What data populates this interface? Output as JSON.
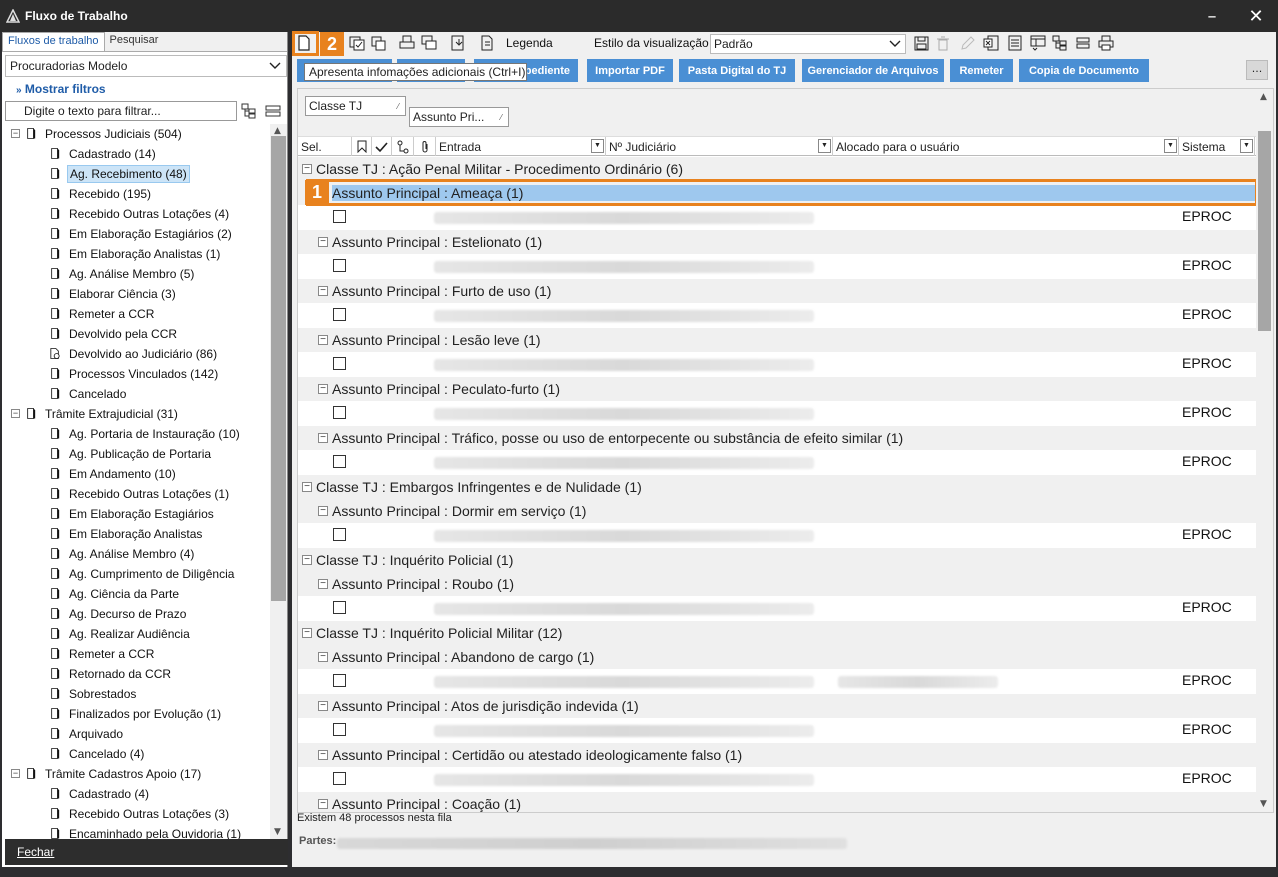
{
  "window": {
    "title": "Fluxo de Trabalho",
    "minimize_glyph": "–",
    "close_glyph": "✕"
  },
  "left": {
    "tabs": [
      "Fluxos de trabalho",
      "Pesquisar"
    ],
    "model_select": "Procuradorias Modelo",
    "show_filters": "Mostrar filtros",
    "filter_placeholder": "Digite o texto para filtrar...",
    "tree": [
      {
        "label": "Processos Judiciais (504)",
        "level": 0,
        "expander": "−"
      },
      {
        "label": "Cadastrado (14)",
        "level": 1
      },
      {
        "label": "Ag. Recebimento (48)",
        "level": 1,
        "selected": true
      },
      {
        "label": "Recebido (195)",
        "level": 1
      },
      {
        "label": "Recebido Outras Lotações (4)",
        "level": 1
      },
      {
        "label": "Em Elaboração Estagiários (2)",
        "level": 1
      },
      {
        "label": "Em Elaboração Analistas (1)",
        "level": 1
      },
      {
        "label": "Ag. Análise Membro (5)",
        "level": 1
      },
      {
        "label": "Elaborar Ciência (3)",
        "level": 1
      },
      {
        "label": "Remeter a CCR",
        "level": 1
      },
      {
        "label": "Devolvido pela CCR",
        "level": 1
      },
      {
        "label": "Devolvido ao Judiciário (86)",
        "level": 1,
        "icon": "gear-doc"
      },
      {
        "label": "Processos Vinculados (142)",
        "level": 1
      },
      {
        "label": "Cancelado",
        "level": 1
      },
      {
        "label": "Trâmite Extrajudicial (31)",
        "level": 0,
        "expander": "−"
      },
      {
        "label": "Ag. Portaria de Instauração (10)",
        "level": 1
      },
      {
        "label": "Ag. Publicação de Portaria",
        "level": 1
      },
      {
        "label": "Em Andamento (10)",
        "level": 1
      },
      {
        "label": "Recebido Outras Lotações (1)",
        "level": 1
      },
      {
        "label": "Em Elaboração Estagiários",
        "level": 1
      },
      {
        "label": "Em Elaboração Analistas",
        "level": 1
      },
      {
        "label": "Ag. Análise Membro (4)",
        "level": 1
      },
      {
        "label": "Ag. Cumprimento de Diligência",
        "level": 1
      },
      {
        "label": "Ag. Ciência da Parte",
        "level": 1
      },
      {
        "label": "Ag. Decurso de Prazo",
        "level": 1
      },
      {
        "label": "Ag. Realizar Audiência",
        "level": 1
      },
      {
        "label": "Remeter a CCR",
        "level": 1
      },
      {
        "label": "Retornado da CCR",
        "level": 1
      },
      {
        "label": "Sobrestados",
        "level": 1
      },
      {
        "label": "Finalizados por Evolução (1)",
        "level": 1
      },
      {
        "label": "Arquivado",
        "level": 1
      },
      {
        "label": "Cancelado (4)",
        "level": 1
      },
      {
        "label": "Trâmite Cadastros Apoio (17)",
        "level": 0,
        "expander": "−"
      },
      {
        "label": "Cadastrado (4)",
        "level": 1
      },
      {
        "label": "Recebido Outras Lotações (3)",
        "level": 1
      },
      {
        "label": "Encaminhado pela Ouvidoria (1)",
        "level": 1
      }
    ],
    "close_button": "Fechar"
  },
  "toolbar": {
    "legend": "Legenda",
    "view_style_label": "Estilo da visualização",
    "view_style_value": "Padrão",
    "tooltip": "Apresenta infomações adicionais (Ctrl+I)",
    "badge_1": "1",
    "badge_2": "2",
    "actions": [
      "Expediente",
      "Importar PDF",
      "Pasta Digital do TJ",
      "Gerenciador de Arquivos",
      "Remeter",
      "Copia de Documento"
    ],
    "action_first_visible": "pediente",
    "more": "..."
  },
  "grid": {
    "group_chips": [
      "Classe TJ",
      "Assunto Pri..."
    ],
    "headers": {
      "sel": "Sel.",
      "entrada": "Entrada",
      "numero": "Nº Judiciário",
      "alocado": "Alocado para o usuário",
      "sistema": "Sistema"
    },
    "rows": [
      {
        "kind": "g1",
        "text": "Classe TJ : Ação Penal Militar - Procedimento Ordinário  (6)"
      },
      {
        "kind": "g2",
        "text": "Assunto Principal : Ameaça  (1)",
        "selected": true
      },
      {
        "kind": "d",
        "sys": "EPROC"
      },
      {
        "kind": "g2",
        "text": "Assunto Principal : Estelionato  (1)"
      },
      {
        "kind": "d",
        "sys": "EPROC"
      },
      {
        "kind": "g2",
        "text": "Assunto Principal : Furto de uso  (1)"
      },
      {
        "kind": "d",
        "sys": "EPROC"
      },
      {
        "kind": "g2",
        "text": "Assunto Principal : Lesão leve  (1)"
      },
      {
        "kind": "d",
        "sys": "EPROC"
      },
      {
        "kind": "g2",
        "text": "Assunto Principal : Peculato-furto  (1)"
      },
      {
        "kind": "d",
        "sys": "EPROC"
      },
      {
        "kind": "g2",
        "text": "Assunto Principal : Tráfico, posse ou uso de entorpecente ou substância de efeito similar  (1)"
      },
      {
        "kind": "d",
        "sys": "EPROC"
      },
      {
        "kind": "g1",
        "text": "Classe TJ : Embargos Infringentes e de Nulidade  (1)"
      },
      {
        "kind": "g2",
        "text": "Assunto Principal : Dormir em serviço  (1)"
      },
      {
        "kind": "d",
        "sys": "EPROC"
      },
      {
        "kind": "g1",
        "text": "Classe TJ : Inquérito Policial  (1)"
      },
      {
        "kind": "g2",
        "text": "Assunto Principal : Roubo  (1)"
      },
      {
        "kind": "d",
        "sys": "EPROC"
      },
      {
        "kind": "g1",
        "text": "Classe TJ : Inquérito Policial Militar  (12)"
      },
      {
        "kind": "g2",
        "text": "Assunto Principal : Abandono de cargo  (1)"
      },
      {
        "kind": "d",
        "sys": "EPROC",
        "extra": true
      },
      {
        "kind": "g2",
        "text": "Assunto Principal : Atos de jurisdição indevida  (1)"
      },
      {
        "kind": "d",
        "sys": "EPROC"
      },
      {
        "kind": "g2",
        "text": "Assunto Principal : Certidão ou atestado ideologicamente falso  (1)"
      },
      {
        "kind": "d",
        "sys": "EPROC"
      },
      {
        "kind": "g2",
        "text": "Assunto Principal : Coação  (1)"
      }
    ]
  },
  "status": {
    "count": "Existem 48 processos nesta fila",
    "partes_label": "Partes:"
  },
  "colors": {
    "accent_orange": "#e8821e",
    "button_blue": "#4a8fd4",
    "selection": "#9ec8ee"
  }
}
